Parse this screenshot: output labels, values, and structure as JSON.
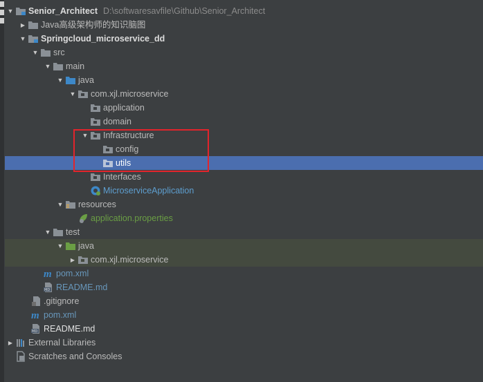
{
  "tree": {
    "items": [
      {
        "label": "Senior_Architect",
        "path": "D:\\softwaresavfile\\Github\\Senior_Architect"
      },
      {
        "label": "Java高级架构师的知识脑图"
      },
      {
        "label": "Springcloud_microservice_dd"
      },
      {
        "label": "src"
      },
      {
        "label": "main"
      },
      {
        "label": "java"
      },
      {
        "label": "com.xjl.microservice"
      },
      {
        "label": "application"
      },
      {
        "label": "domain"
      },
      {
        "label": "Infrastructure"
      },
      {
        "label": "config"
      },
      {
        "label": "utils"
      },
      {
        "label": "Interfaces"
      },
      {
        "label": "MicroserviceApplication"
      },
      {
        "label": "resources"
      },
      {
        "label": "application.properties"
      },
      {
        "label": "test"
      },
      {
        "label": "java"
      },
      {
        "label": "com.xjl.microservice"
      },
      {
        "label": "pom.xml"
      },
      {
        "label": "README.md"
      },
      {
        "label": ".gitignore"
      },
      {
        "label": "pom.xml"
      },
      {
        "label": "README.md"
      },
      {
        "label": "External Libraries"
      },
      {
        "label": "Scratches and Consoles"
      }
    ]
  },
  "colors": {
    "background": "#3c3f41",
    "selection": "#4b6eaf",
    "highlight_box": "#e3242b",
    "test_row_background": "#444a3f"
  },
  "icons": [
    "project-folder-icon",
    "folder-icon",
    "module-folder-icon",
    "source-folder-icon",
    "package-icon",
    "spring-class-icon",
    "resources-folder-icon",
    "spring-properties-icon",
    "test-folder-icon",
    "maven-icon",
    "markdown-icon",
    "gitignore-icon",
    "libraries-icon",
    "scratches-icon"
  ]
}
